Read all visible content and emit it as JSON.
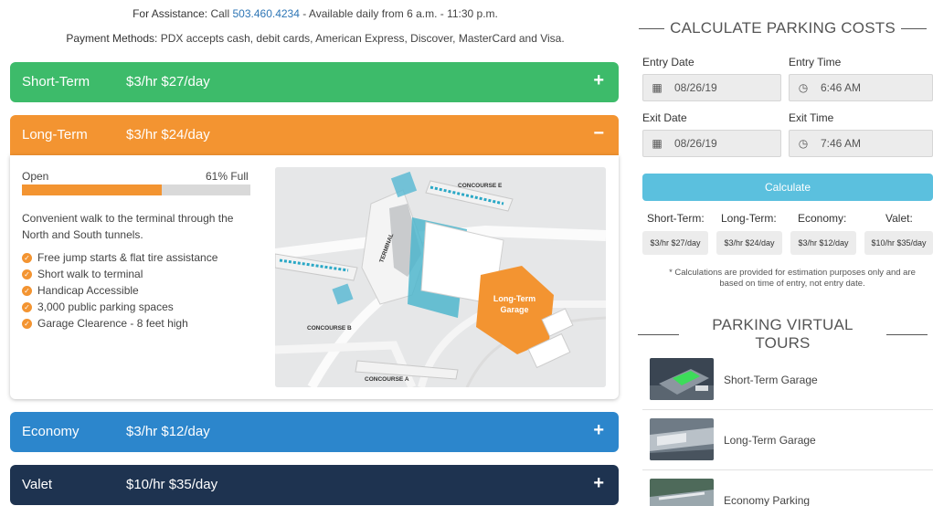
{
  "info": {
    "assist_prefix": "For Assistance:",
    "call": "Call",
    "phone": "503.460.4234",
    "hours": "- Available daily from 6 a.m. - 11:30 p.m.",
    "payment_prefix": "Payment Methods:",
    "payment_text": "PDX accepts cash, debit cards, American Express, Discover, MasterCard and Visa."
  },
  "lots": {
    "short": {
      "name": "Short-Term",
      "price": "$3/hr $27/day",
      "toggle": "+",
      "color": "#3dbb6a"
    },
    "long": {
      "name": "Long-Term",
      "price": "$3/hr $24/day",
      "toggle": "−",
      "color": "#f39431"
    },
    "economy": {
      "name": "Economy",
      "price": "$3/hr $12/day",
      "toggle": "+",
      "color": "#2c86cc"
    },
    "valet": {
      "name": "Valet",
      "price": "$10/hr $35/day",
      "toggle": "+",
      "color": "#1e3350"
    }
  },
  "long_panel": {
    "status": "Open",
    "full_label": "61% Full",
    "full_fraction": 0.61,
    "description": "Convenient walk to the terminal through the North and South tunnels.",
    "features": [
      "Free jump starts & flat tire assistance",
      "Short walk to terminal",
      "Handicap Accessible",
      "3,000 public parking spaces",
      "Garage Clearence - 8 feet high"
    ],
    "map_labels": {
      "concourse_e": "CONCOURSE E",
      "terminal": "TERMINAL",
      "concourse_b": "CONCOURSE B",
      "concourse_a": "CONCOURSE A",
      "garage_line1": "Long-Term",
      "garage_line2": "Garage"
    }
  },
  "calculator": {
    "title": "CALCULATE PARKING COSTS",
    "entry_date_label": "Entry Date",
    "entry_date": "08/26/19",
    "entry_time_label": "Entry Time",
    "entry_time": "6:46 AM",
    "exit_date_label": "Exit Date",
    "exit_date": "08/26/19",
    "exit_time_label": "Exit Time",
    "exit_time": "7:46 AM",
    "button": "Calculate",
    "rates": [
      {
        "label": "Short-Term:",
        "value": "$3/hr $27/day"
      },
      {
        "label": "Long-Term:",
        "value": "$3/hr $24/day"
      },
      {
        "label": "Economy:",
        "value": "$3/hr $12/day"
      },
      {
        "label": "Valet:",
        "value": "$10/hr $35/day"
      }
    ],
    "note": "* Calculations are provided for estimation purposes only and are based on time of entry, not entry date."
  },
  "tours": {
    "title": "PARKING VIRTUAL TOURS",
    "items": [
      {
        "name": "Short-Term Garage",
        "icon": "short-term-garage-thumbnail"
      },
      {
        "name": "Long-Term Garage",
        "icon": "long-term-garage-thumbnail"
      },
      {
        "name": "Economy Parking",
        "icon": "economy-parking-thumbnail"
      }
    ]
  }
}
